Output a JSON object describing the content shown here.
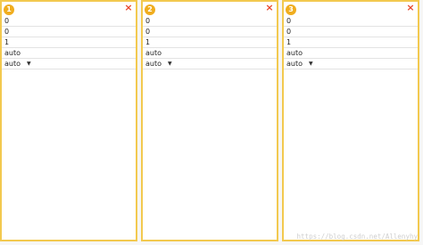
{
  "panels": [
    {
      "badge": "1",
      "close_glyph": "×",
      "close_icon": "close-icon",
      "rows": [
        "0",
        "0",
        "1",
        "auto"
      ],
      "select_value": "auto"
    },
    {
      "badge": "2",
      "close_glyph": "×",
      "close_icon": "close-icon",
      "rows": [
        "0",
        "0",
        "1",
        "auto"
      ],
      "select_value": "auto"
    },
    {
      "badge": "3",
      "close_glyph": "×",
      "close_icon": "close-icon",
      "rows": [
        "0",
        "0",
        "1",
        "auto"
      ],
      "select_value": "auto"
    }
  ],
  "caret_glyph": "▼",
  "watermark": "https://blog.csdn.net/Allenyhy",
  "colors": {
    "border": "#f3c94f",
    "badge": "#f0ad1e",
    "close": "#e8472c"
  }
}
